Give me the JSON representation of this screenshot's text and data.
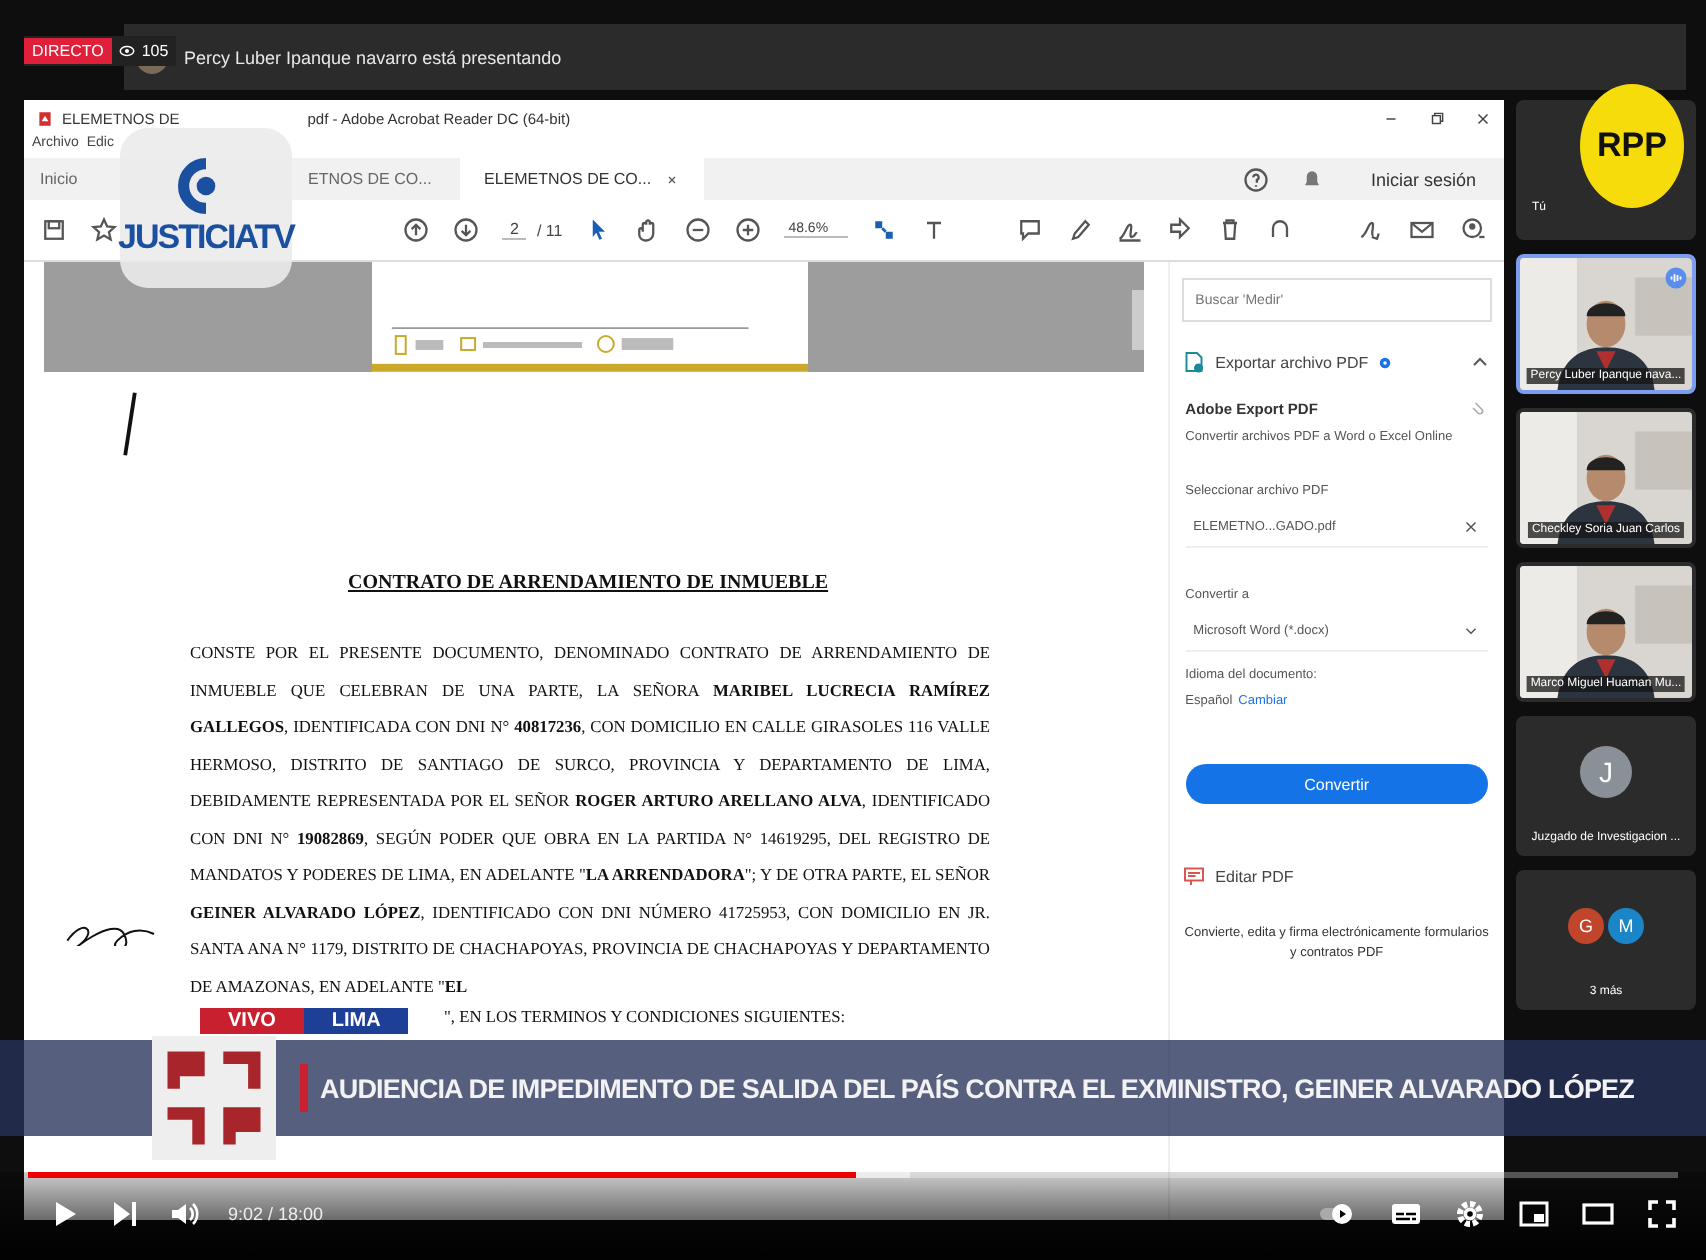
{
  "live_badge": {
    "label": "DIRECTO",
    "viewers": "105"
  },
  "meeting_bar": {
    "presenter_text": "Percy Luber Ipanque navarro está presentando"
  },
  "acrobat": {
    "title_start": "ELEMETNOS DE",
    "title_end": "pdf - Adobe Acrobat Reader DC (64-bit)",
    "menu": [
      "Archivo",
      "Edic"
    ],
    "tabs": [
      {
        "label": "Inicio",
        "selected": false,
        "closable": false
      },
      {
        "label": "ETNOS DE CO...",
        "selected": false,
        "closable": false
      },
      {
        "label": "ELEMETNOS DE CO...",
        "selected": true,
        "closable": true
      }
    ],
    "sign_in": "Iniciar sesión",
    "page": "2",
    "page_count": "/ 11",
    "zoom": "48.6%",
    "document": {
      "title": "CONTRATO DE ARRENDAMIENTO DE INMUEBLE",
      "body": "CONSTE POR EL PRESENTE DOCUMENTO, DENOMINADO CONTRATO DE ARRENDAMIENTO DE INMUEBLE QUE CELEBRAN DE UNA PARTE, LA SEÑORA **MARIBEL LUCRECIA RAMÍREZ GALLEGOS**, IDENTIFICADA CON DNI N° **40817236**, CON DOMICILIO EN CALLE GIRASOLES 116 VALLE HERMOSO, DISTRITO DE SANTIAGO DE SURCO, PROVINCIA Y DEPARTAMENTO DE LIMA, DEBIDAMENTE REPRESENTADA POR EL SEÑOR **ROGER ARTURO ARELLANO ALVA**, IDENTIFICADO CON DNI N° **19082869**, SEGÚN PODER QUE OBRA EN LA PARTIDA N° 14619295, DEL REGISTRO DE MANDATOS Y PODERES DE LIMA, EN ADELANTE \"**LA ARRENDADORA**\"; Y DE OTRA PARTE, EL SEÑOR **GEINER ALVARADO LÓPEZ**, IDENTIFICADO CON DNI NÚMERO 41725953, CON DOMICILIO EN JR. SANTA ANA N° 1179, DISTRITO DE CHACHAPOYAS, PROVINCIA DE CHACHAPOYAS Y DEPARTAMENTO DE AMAZONAS, EN ADELANTE \"**EL**",
      "last_line": "\", EN LOS TERMINOS Y CONDICIONES SIGUIENTES:"
    },
    "panel": {
      "search_placeholder": "Buscar 'Medir'",
      "section": "Exportar archivo PDF",
      "heading": "Adobe Export PDF",
      "description": "Convertir archivos PDF a Word o Excel Online",
      "file_label": "Seleccionar archivo PDF",
      "file": "ELEMETNO...GADO.pdf",
      "convert_label": "Convertir a",
      "format": "Microsoft Word (*.docx)",
      "language_label": "Idioma del documento:",
      "language": "Español",
      "change_link": "Cambiar",
      "convert_button": "Convertir",
      "edit_section": "Editar PDF",
      "promo": "Convierte, edita y firma electrónicamente formularios y contratos PDF"
    }
  },
  "participants": [
    {
      "kind": "self",
      "name": "Tú",
      "speaking": false
    },
    {
      "kind": "video",
      "name": "Percy Luber Ipanque nava...",
      "speaking": true
    },
    {
      "kind": "video",
      "name": "Checkley Soria Juan Carlos",
      "speaking": false
    },
    {
      "kind": "video",
      "name": "Marco Miguel Huaman Mu...",
      "speaking": false
    },
    {
      "kind": "avatar",
      "initial": "J",
      "color": "#8a9097",
      "name": "Juzgado de Investigacion ...",
      "speaking": false
    },
    {
      "kind": "more",
      "avatars": [
        {
          "initial": "G",
          "color": "#c0452b"
        },
        {
          "initial": "M",
          "color": "#1a86c8"
        }
      ],
      "name": "3 más",
      "speaking": false
    }
  ],
  "channel_logo": {
    "text": "JUSTICIATV"
  },
  "network_logo": {
    "text": "RPP"
  },
  "chyron": {
    "tags": [
      "VIVO",
      "LIMA"
    ],
    "headline": "AUDIENCIA DE IMPEDIMENTO DE SALIDA DEL PAÍS CONTRA EL EXMINISTRO, GEINER ALVARADO LÓPEZ"
  },
  "player": {
    "time": "9:02 / 18:00",
    "progress": {
      "level": 0.502
    },
    "buffered": {
      "level": 0.535
    }
  }
}
